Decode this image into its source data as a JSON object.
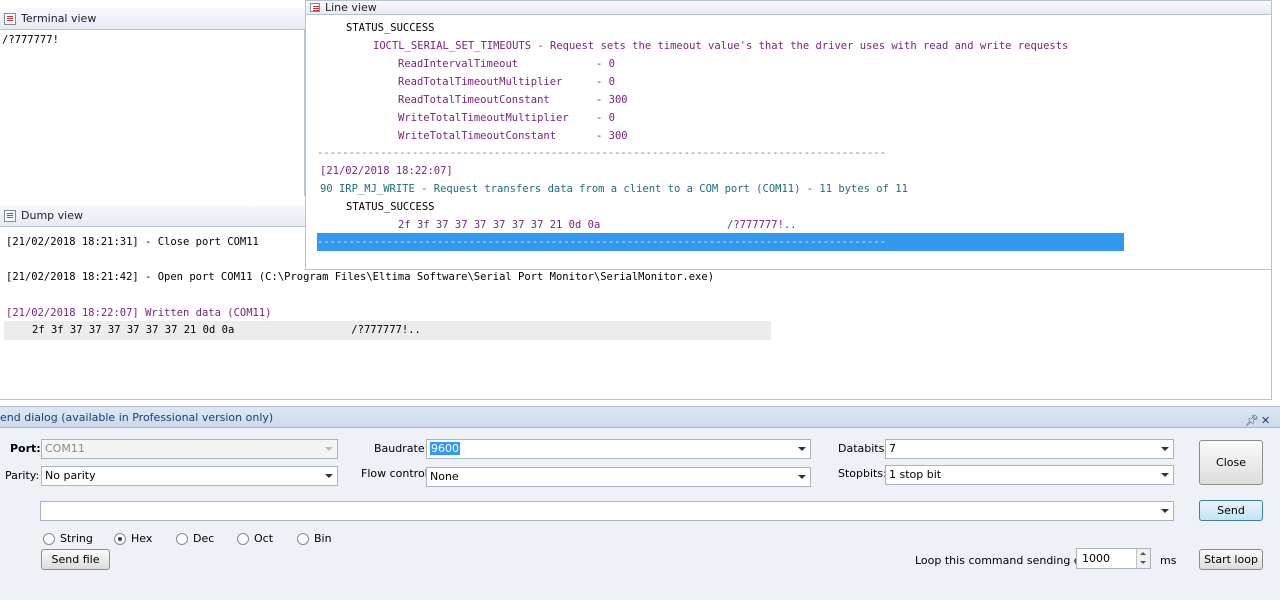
{
  "terminal_view": {
    "title": "Terminal view",
    "content": "/?777777!"
  },
  "dump_view": {
    "title": "Dump view",
    "lines": [
      "[21/02/2018 18:21:31] - Close port COM11",
      "[21/02/2018 18:21:42] - Open port COM11 (C:\\Program Files\\Eltima Software\\Serial Port Monitor\\SerialMonitor.exe)",
      "[21/02/2018 18:22:07] Written data (COM11)"
    ],
    "hex": "2f 3f 37 37 37 37 37 37 21 0d 0a",
    "ascii": "/?777777!.."
  },
  "line_view": {
    "title": "Line view",
    "status_success_1": "STATUS_SUCCESS",
    "ioctl": "IOCTL_SERIAL_SET_TIMEOUTS - Request sets the timeout value's that the driver uses with read and write requests",
    "params": [
      {
        "name": "ReadIntervalTimeout",
        "value": "- 0"
      },
      {
        "name": "ReadTotalTimeoutMultiplier",
        "value": "- 0"
      },
      {
        "name": "ReadTotalTimeoutConstant",
        "value": "- 300"
      },
      {
        "name": "WriteTotalTimeoutMultiplier",
        "value": "- 0"
      },
      {
        "name": "WriteTotalTimeoutConstant",
        "value": "- 300"
      }
    ],
    "separator": "------------------------------------------------------------------------------------------",
    "timestamp": "[21/02/2018 18:22:07]",
    "irp": "90 IRP_MJ_WRITE - Request transfers data from a client to a COM port (COM11) - 11 bytes of 11",
    "status_success_2": "STATUS_SUCCESS",
    "hex": "2f 3f 37 37 37 37 37 37 21 0d 0a",
    "ascii": "/?777777!..",
    "selected_separator": "------------------------------------------------------------------------------------------"
  },
  "send_dialog": {
    "title": "end dialog (available in Professional version only)",
    "pin_icon": "pin-icon",
    "close_icon": "close-icon",
    "port_label": "Port:",
    "port_value": "COM11",
    "parity_label": "Parity:",
    "parity_value": "No parity",
    "baudrate_label": "Baudrate:",
    "baudrate_value": "9600",
    "flow_label": "Flow control:",
    "flow_value": "None",
    "databits_label": "Databits:",
    "databits_value": "7",
    "stopbits_label": "Stopbits:",
    "stopbits_value": "1 stop bit",
    "close_button": "Close",
    "send_button": "Send",
    "command_value": "",
    "formats": [
      "String",
      "Hex",
      "Dec",
      "Oct",
      "Bin"
    ],
    "selected_format": "Hex",
    "send_file_button": "Send file",
    "loop_label": "Loop this command sending every",
    "loop_value": "1000",
    "loop_unit": "ms",
    "start_loop_button": "Start loop"
  }
}
